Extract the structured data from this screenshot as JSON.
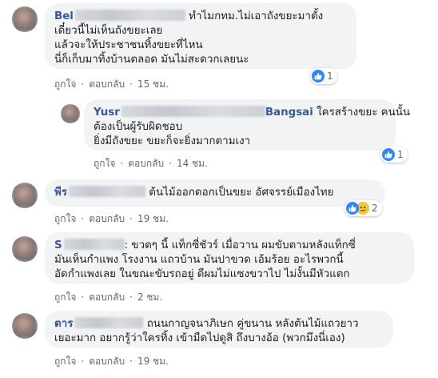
{
  "labels": {
    "like": "ถูกใจ",
    "reply": "ตอบกลับ",
    "dot": "·"
  },
  "comments": [
    {
      "name": "Bel",
      "text_lines": [
        "ทำไมกทม.ไม่เอาถังขยะมาตั้ง",
        "เดี๋ยวนี้ไม่เห็นถังขยะเลย",
        "แล้วจะให้ประชาชนทิ้งขยะที่ไหน",
        "นี่ก็เก็บมาทิ้งบ้านตลอด มันไม่สะดวกเลยนะ"
      ],
      "time": "15 ชม.",
      "reaction_count": "1",
      "reaction_icons": [
        "like-icon"
      ]
    },
    {
      "name": "Yusr",
      "name_tail": "Bangsai",
      "name_tail_text": "ใครสร้างขยะ คนนั้น",
      "text_lines": [
        "ต้องเป็นผู้รับผิดชอบ",
        "ยิ่งมีถังขยะ ขยะก็จะยิ่งมากตามเงา"
      ],
      "time": "14 ชม.",
      "reaction_count": "1",
      "reaction_icons": [
        "like-icon"
      ]
    },
    {
      "name": "พีร",
      "first_text": "ต้นไม้ออกดอกเป็นขยะ อัศจรรย์เมืองไทย",
      "time": "19 ชม.",
      "reaction_count": "2",
      "reaction_icons": [
        "like-icon",
        "sad-icon"
      ]
    },
    {
      "name": "S",
      "first_text": ": ขวดๆ นี้ แท็กซี่ชัวร์ เมื่อวาน ผมขับตามหลังแท็กซี่",
      "text_lines": [
        "มันเห็นกำแพง โรงงาน แถวบ้าน มันปาขวด เอ้มร้อย อะไรพวกนี้",
        "อัดกำแพงเลย ในขณะขับรถอยู่ ดีผมไม่แซงขวาไป ไม่งั้นมีหัวแตก"
      ],
      "time": "2 ชม."
    },
    {
      "name": "ตาร",
      "first_text": "ถนนกาญจนาภิเษก คู่ขนาน หลังต้นไม้แถวยาว",
      "text_lines": [
        "เยอะมาก อยากรู้ว่าใครทิ้ง เข้ามืดไปดูสิ ถึงบางอ้อ (พวกมึงนี่เอง)"
      ],
      "time": "19 ชม."
    }
  ]
}
